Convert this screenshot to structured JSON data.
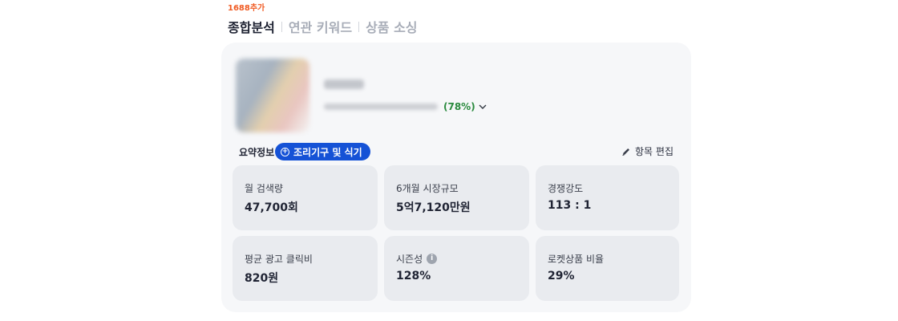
{
  "header": {
    "badge": "1688추가",
    "tabs": [
      {
        "label": "종합분석",
        "active": true
      },
      {
        "label": "연관 키워드",
        "active": false
      },
      {
        "label": "상품 소싱",
        "active": false
      }
    ]
  },
  "product": {
    "match_pct": "(78%)",
    "chevron_icon": "chevron-down-icon"
  },
  "summary": {
    "label": "요약정보",
    "category_chip": "조리기구 및 식기",
    "edit_label": "항목 편집"
  },
  "stats": [
    {
      "label": "월 검색량",
      "value": "47,700회"
    },
    {
      "label": "6개월 시장규모",
      "value": "5억7,120만원"
    },
    {
      "label": "경쟁강도",
      "value": "113 : 1"
    },
    {
      "label": "평균 광고 클릭비",
      "value": "820원"
    },
    {
      "label": "시즌성",
      "value": "128%"
    },
    {
      "label": "로켓상품 비율",
      "value": "29%"
    }
  ],
  "colors": {
    "accent": "#1552d6",
    "badge": "#f05a22",
    "match": "#2a8a3e"
  }
}
